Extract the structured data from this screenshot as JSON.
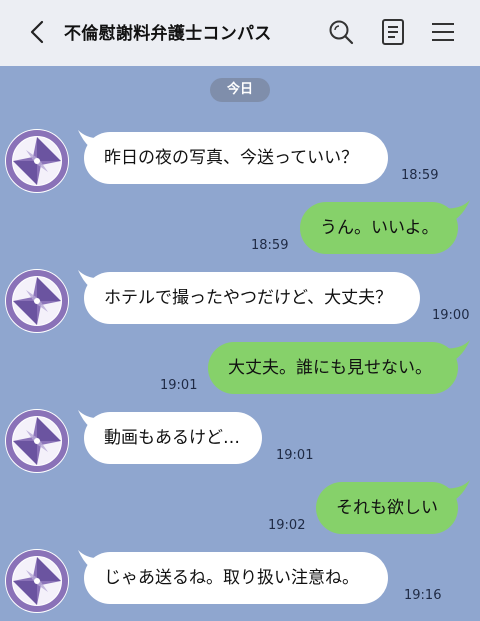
{
  "header": {
    "title": "不倫慰謝料弁護士コンパス",
    "icons": [
      "back-icon",
      "search-icon",
      "notes-icon",
      "menu-icon"
    ]
  },
  "date_divider": "今日",
  "messages": [
    {
      "side": "in",
      "text": "昨日の夜の写真、今送っていい？",
      "time": "18:59"
    },
    {
      "side": "out",
      "text": "うん。いいよ。",
      "time": "18:59"
    },
    {
      "side": "in",
      "text": "ホテルで撮ったやつだけど、大丈夫？",
      "time": "19:00"
    },
    {
      "side": "out",
      "text": "大丈夫。誰にも見せない。",
      "time": "19:01"
    },
    {
      "side": "in",
      "text": "動画もあるけど…",
      "time": "19:01"
    },
    {
      "side": "out",
      "text": "それも欲しい",
      "time": "19:02"
    },
    {
      "side": "in",
      "text": "じゃあ送るね。取り扱い注意ね。",
      "time": "19:16"
    }
  ],
  "colors": {
    "background": "#8fa6cf",
    "header": "#eceef3",
    "incoming_bubble": "#ffffff",
    "outgoing_bubble": "#86d16a",
    "date_pill": "#7f8eab",
    "avatar_ring": "#8a72b8"
  }
}
